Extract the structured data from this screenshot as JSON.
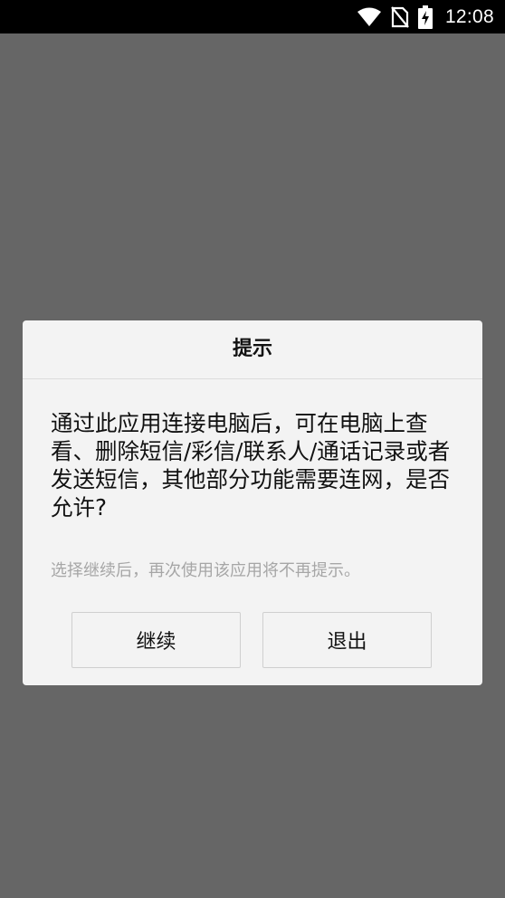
{
  "status_bar": {
    "time": "12:08",
    "icons": [
      "wifi-icon",
      "no-sim-icon",
      "battery-charging-icon"
    ]
  },
  "dialog": {
    "title": "提示",
    "message": "通过此应用连接电脑后，可在电脑上查看、删除短信/彩信/联系人/通话记录或者发送短信，其他部分功能需要连网，是否允许?",
    "hint": "选择继续后，再次使用该应用将不再提示。",
    "buttons": {
      "continue": "继续",
      "exit": "退出"
    }
  },
  "colors": {
    "overlay": "#666666",
    "dialog_background": "#f3f3f3",
    "status_bar": "#000000",
    "hint_text": "#a6a6a6"
  }
}
